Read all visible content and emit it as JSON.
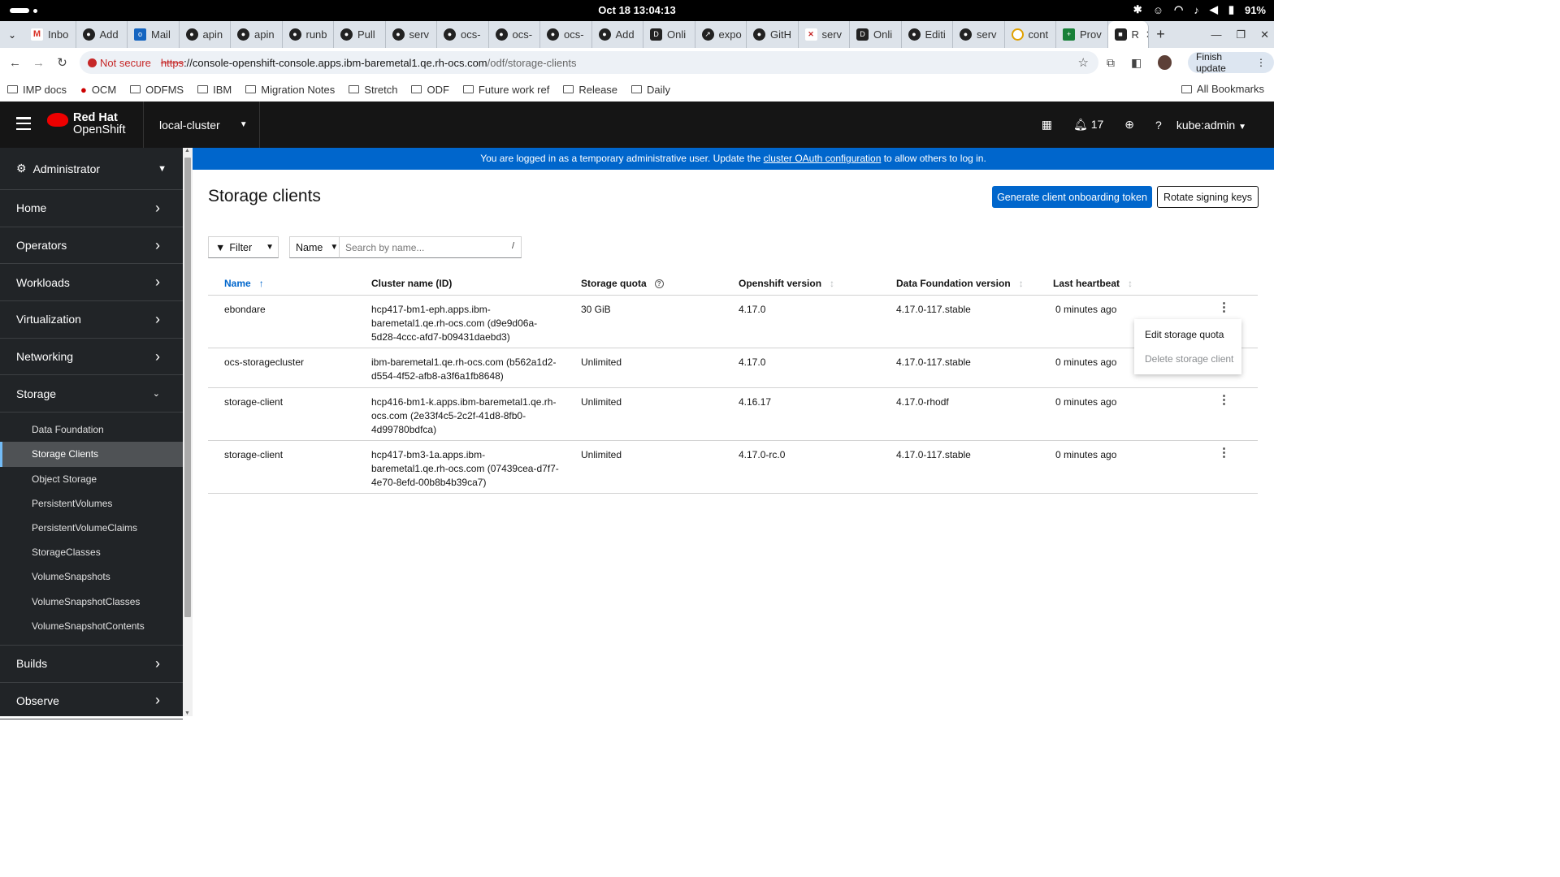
{
  "os": {
    "clock": "Oct 18  13:04:13",
    "battery": "91%"
  },
  "browser": {
    "tabs": [
      {
        "icon": "gmail-icon",
        "title": "Inbo"
      },
      {
        "icon": "github-icon",
        "title": "Add"
      },
      {
        "icon": "outlook-icon",
        "title": "Mail"
      },
      {
        "icon": "github-icon",
        "title": "apin"
      },
      {
        "icon": "github-icon",
        "title": "apin"
      },
      {
        "icon": "github-icon",
        "title": "runb"
      },
      {
        "icon": "github-icon",
        "title": "Pull"
      },
      {
        "icon": "github-icon",
        "title": "serv"
      },
      {
        "icon": "github-icon",
        "title": "ocs-"
      },
      {
        "icon": "github-icon",
        "title": "ocs-"
      },
      {
        "icon": "github-icon",
        "title": "ocs-"
      },
      {
        "icon": "github-icon",
        "title": "Add"
      },
      {
        "icon": "doc-icon",
        "title": "Onli"
      },
      {
        "icon": "export-icon",
        "title": "expo"
      },
      {
        "icon": "github-icon",
        "title": "GitH"
      },
      {
        "icon": "x-icon",
        "title": "serv"
      },
      {
        "icon": "doc-icon",
        "title": "Onli"
      },
      {
        "icon": "github-icon",
        "title": "Editi"
      },
      {
        "icon": "github-icon",
        "title": "serv"
      },
      {
        "icon": "cs-icon",
        "title": "cont"
      },
      {
        "icon": "sheets-icon",
        "title": "Prov"
      }
    ],
    "active_tab": {
      "title": "R"
    },
    "omnibox": {
      "security": "Not secure",
      "scheme": "https",
      "host": "://console-openshift-console.apps.ibm-baremetal1.qe.rh-ocs.com",
      "path": "/odf/storage-clients"
    },
    "finish_update": "Finish update",
    "bookmarks": [
      "IMP docs",
      "OCM",
      "ODFMS",
      "IBM",
      "Migration Notes",
      "Stretch",
      "ODF",
      "Future work ref",
      "Release",
      "Daily"
    ],
    "all_bookmarks": "All Bookmarks"
  },
  "masthead": {
    "brand_line1": "Red Hat",
    "brand_line2": "OpenShift",
    "cluster": "local-cluster",
    "notifications_count": "17",
    "user": "kube:admin"
  },
  "sidebar": {
    "perspective": "Administrator",
    "sections_top": [
      "Home",
      "Operators",
      "Workloads",
      "Virtualization",
      "Networking"
    ],
    "storage_label": "Storage",
    "storage_items": [
      "Data Foundation",
      "Storage Clients",
      "Object Storage",
      "PersistentVolumes",
      "PersistentVolumeClaims",
      "StorageClasses",
      "VolumeSnapshots",
      "VolumeSnapshotClasses",
      "VolumeSnapshotContents"
    ],
    "active_item": "Storage Clients",
    "sections_bottom": [
      "Builds",
      "Observe"
    ]
  },
  "banner": {
    "prefix": "You are logged in as a temporary administrative user. Update the ",
    "link": "cluster OAuth configuration",
    "suffix": " to allow others to log in."
  },
  "page": {
    "title": "Storage clients",
    "primary_button": "Generate client onboarding token",
    "secondary_button": "Rotate signing keys",
    "filter_label": "Filter",
    "name_select": "Name",
    "search_placeholder": "Search by name...",
    "search_shortcut": "/"
  },
  "table": {
    "columns": [
      "Name",
      "Cluster name (ID)",
      "Storage quota",
      "Openshift version",
      "Data Foundation version",
      "Last heartbeat"
    ],
    "rows": [
      {
        "name": "ebondare",
        "cluster": "hcp417-bm1-eph.apps.ibm-baremetal1.qe.rh-ocs.com (d9e9d06a-5d28-4ccc-afd7-b09431daebd3)",
        "quota": "30 GiB",
        "ocp": "4.17.0",
        "odf": "4.17.0-117.stable",
        "heartbeat": "0 minutes ago"
      },
      {
        "name": "ocs-storagecluster",
        "cluster": "ibm-baremetal1.qe.rh-ocs.com (b562a1d2-d554-4f52-afb8-a3f6a1fb8648)",
        "quota": "Unlimited",
        "ocp": "4.17.0",
        "odf": "4.17.0-117.stable",
        "heartbeat": "0 minutes ago"
      },
      {
        "name": "storage-client",
        "cluster": "hcp416-bm1-k.apps.ibm-baremetal1.qe.rh-ocs.com (2e33f4c5-2c2f-41d8-8fb0-4d99780bdfca)",
        "quota": "Unlimited",
        "ocp": "4.16.17",
        "odf": "4.17.0-rhodf",
        "heartbeat": "0 minutes ago"
      },
      {
        "name": "storage-client",
        "cluster": "hcp417-bm3-1a.apps.ibm-baremetal1.qe.rh-ocs.com (07439cea-d7f7-4e70-8efd-00b8b4b39ca7)",
        "quota": "Unlimited",
        "ocp": "4.17.0-rc.0",
        "odf": "4.17.0-117.stable",
        "heartbeat": "0 minutes ago"
      }
    ]
  },
  "context_menu": {
    "items": [
      "Edit storage quota",
      "Delete storage client"
    ],
    "disabled": [
      false,
      true
    ]
  }
}
